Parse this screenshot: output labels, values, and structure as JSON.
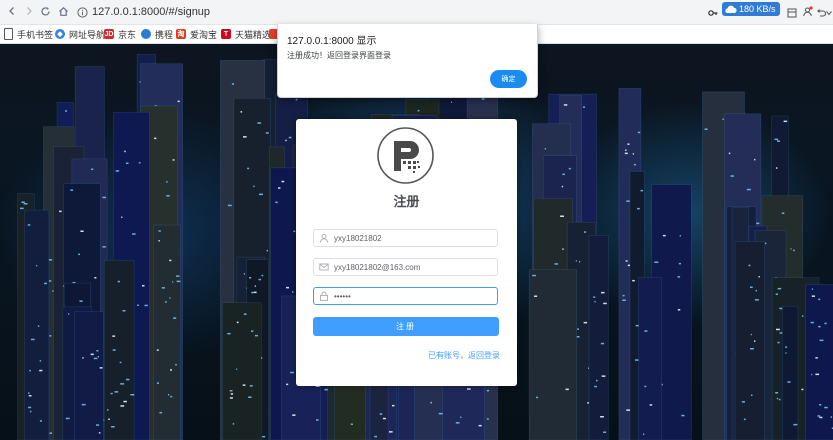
{
  "browser": {
    "url": "127.0.0.1:8000/#/signup",
    "speed": "180 KB/s",
    "icons": [
      "back-icon",
      "forward-icon",
      "reload-icon",
      "home-icon",
      "info-icon",
      "key-icon",
      "undo-icon",
      "menu-icon"
    ]
  },
  "bookmarks": [
    {
      "label": "手机书签",
      "icon": "mobile-icon",
      "color": "#4a4a4a"
    },
    {
      "label": "网址导航",
      "icon": "compass-icon",
      "color": "#2f86e4"
    },
    {
      "label": "京东",
      "icon": "jd-icon",
      "color": "#d8282f",
      "glyph": "JD"
    },
    {
      "label": "携程",
      "icon": "ctrip-icon",
      "color": "#2a7ad6"
    },
    {
      "label": "爱淘宝",
      "icon": "taobao-icon",
      "color": "#e03a1c"
    },
    {
      "label": "天猫精选",
      "icon": "tmall-icon",
      "color": "#d6001c",
      "glyph": "T"
    },
    {
      "label": "",
      "icon": "bookmark-icon",
      "color": "#e43e2b"
    }
  ],
  "signup": {
    "title": "注册",
    "username": "yxy18021802",
    "email": "yxy18021802@163.com",
    "password": "••••••",
    "submit_label": "注册",
    "login_link": "已有账号，返回登录"
  },
  "dialog": {
    "title": "127.0.0.1:8000 显示",
    "message": "注册成功！返回登录界面登录",
    "ok_label": "确定"
  },
  "colors": {
    "accent": "#409eff",
    "dialog_button": "#1a8cf1",
    "background": "#0b1018"
  }
}
